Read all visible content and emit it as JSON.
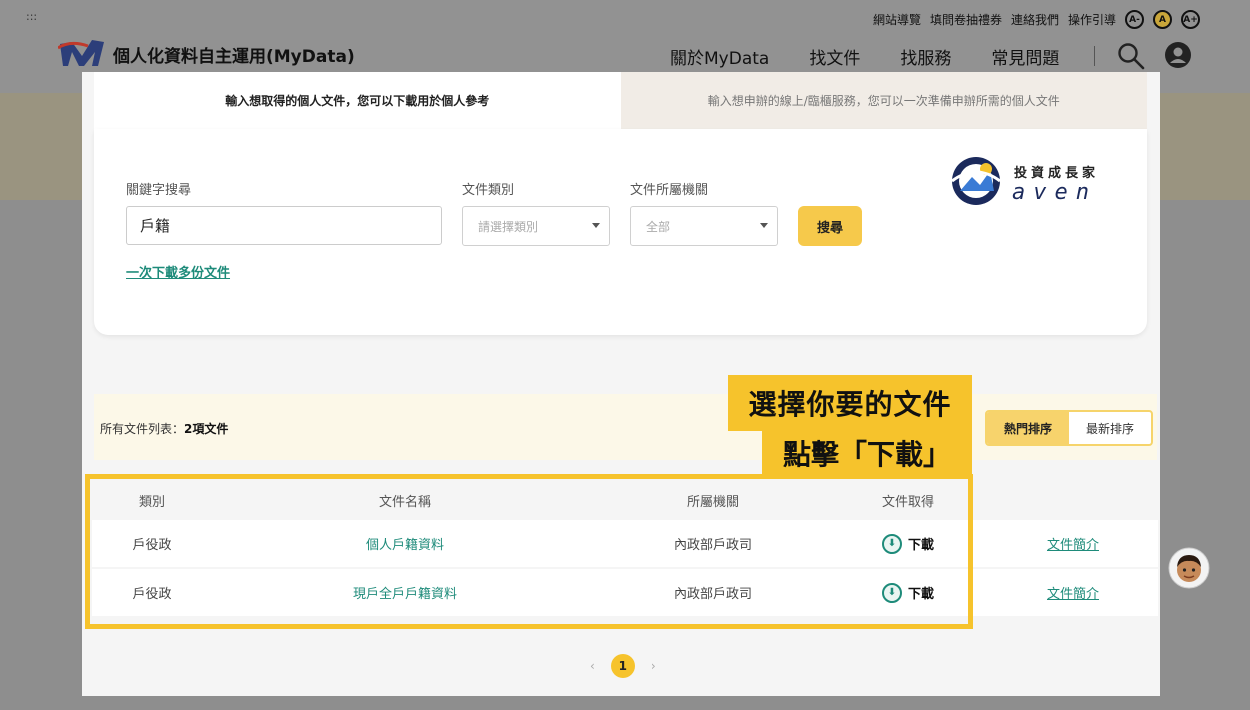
{
  "header": {
    "grip": ":::",
    "top_links": [
      "網站導覽",
      "填問卷抽禮券",
      "連絡我們",
      "操作引導"
    ],
    "font_buttons": [
      "A-",
      "A",
      "A+"
    ],
    "site_title": "個人化資料自主運用(MyData)",
    "nav": [
      "關於MyData",
      "找文件",
      "找服務",
      "常見問題"
    ],
    "active_nav": "找文件"
  },
  "tabs": {
    "find_document": "輸入想取得的個人文件，您可以下載用於個人參考",
    "find_service": "輸入想申辦的線上/臨櫃服務，您可以一次準備申辦所需的個人文件"
  },
  "search": {
    "keyword_label": "關鍵字搜尋",
    "keyword_value": "戶籍",
    "category_label": "文件類別",
    "category_placeholder": "請選擇類別",
    "agency_label": "文件所屬機關",
    "agency_value": "全部",
    "search_button": "搜尋",
    "multi_download_link": "一次下載多份文件"
  },
  "brand": {
    "cn": "投資成長家",
    "en": "aven"
  },
  "list": {
    "count_label": "所有文件列表：",
    "count_value": "2項文件",
    "sort_popular": "熱門排序",
    "sort_latest": "最新排序"
  },
  "callout": {
    "line1": "選擇你要的文件",
    "line2": "點擊「下載」"
  },
  "table": {
    "headers": [
      "類別",
      "文件名稱",
      "所屬機關",
      "文件取得"
    ],
    "rows": [
      {
        "category": "戶役政",
        "name": "個人戶籍資料",
        "agency": "內政部戶政司",
        "action": "下載",
        "intro": "文件簡介"
      },
      {
        "category": "戶役政",
        "name": "現戶全戶戶籍資料",
        "agency": "內政部戶政司",
        "action": "下載",
        "intro": "文件簡介"
      }
    ]
  },
  "pagination": {
    "prev": "‹",
    "current": "1",
    "next": "›"
  },
  "colors": {
    "accent_yellow": "#f6c32c",
    "teal": "#1e8b7a",
    "navy": "#1b2a5c"
  }
}
